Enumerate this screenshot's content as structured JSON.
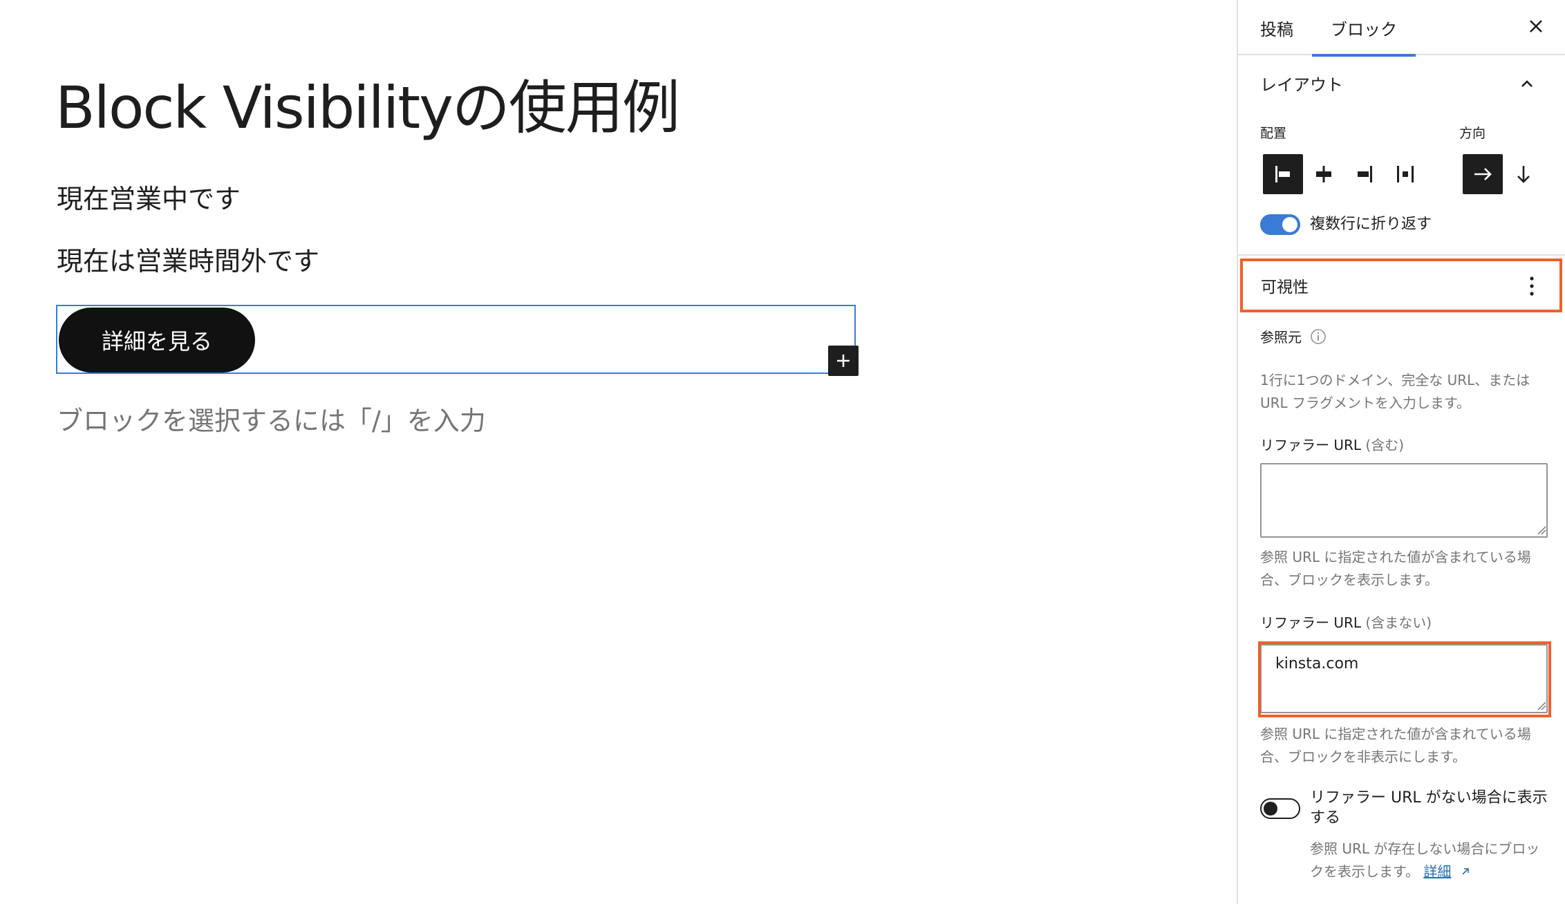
{
  "editor": {
    "title": "Block Visibilityの使用例",
    "paragraph_1": "現在営業中です",
    "paragraph_2": "現在は営業時間外です",
    "button_label": "詳細を見る",
    "placeholder": "ブロックを選択するには「/」を入力"
  },
  "sidebar": {
    "tabs": [
      {
        "label": "投稿"
      },
      {
        "label": "ブロック",
        "active": true
      }
    ],
    "layout_panel": {
      "title": "レイアウト",
      "align_label": "配置",
      "direction_label": "方向",
      "wrap_label": "複数行に折り返す",
      "wrap_enabled": true,
      "align_selected": "left",
      "direction_selected": "horizontal"
    },
    "visibility_panel": {
      "title": "可視性",
      "referrer_title": "参照元",
      "referrer_help": "1行に1つのドメイン、完全な URL、または URL フラグメントを入力します。",
      "include_label": "リファラー URL",
      "include_suffix": "(含む)",
      "include_value": "",
      "include_help": "参照 URL に指定された値が含まれている場合、ブロックを表示します。",
      "exclude_label": "リファラー URL",
      "exclude_suffix": "(含まない)",
      "exclude_value": "kinsta.com",
      "exclude_help": "参照 URL に指定された値が含まれている場合、ブロックを非表示にします。",
      "no_referrer_label": "リファラー URL がない場合に表示する",
      "no_referrer_enabled": false,
      "no_referrer_help": "参照 URL が存在しない場合にブロックを表示します。",
      "details_link": "詳細"
    }
  },
  "colors": {
    "accent": "#3a7bd5",
    "highlight": "#f0612a",
    "button_bg": "#111111",
    "muted_text": "#757575"
  }
}
